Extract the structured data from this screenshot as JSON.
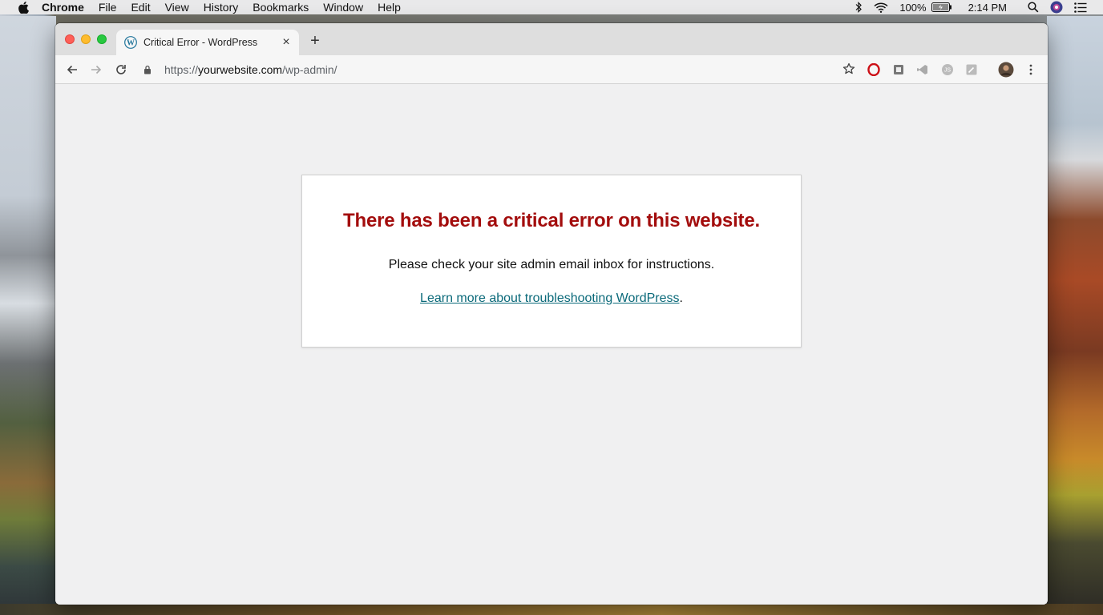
{
  "menubar": {
    "app_name": "Chrome",
    "items": [
      "File",
      "Edit",
      "View",
      "History",
      "Bookmarks",
      "Window",
      "Help"
    ],
    "battery": "100%",
    "time": "2:14 PM"
  },
  "tab": {
    "title": "Critical Error - WordPress",
    "close_glyph": "×"
  },
  "newtab": {
    "glyph": "+"
  },
  "toolbar": {
    "url_scheme": "https://",
    "url_host": "yourwebsite.com",
    "url_path": "/wp-admin/"
  },
  "page": {
    "error_title": "There has been a critical error on this website.",
    "error_message": "Please check your site admin email inbox for instructions.",
    "link_text": "Learn more about troubleshooting WordPress",
    "link_suffix": "."
  },
  "colors": {
    "error_title": "#a30d0d",
    "link": "#0b6a7a",
    "content_bg": "#f0f0f1"
  }
}
